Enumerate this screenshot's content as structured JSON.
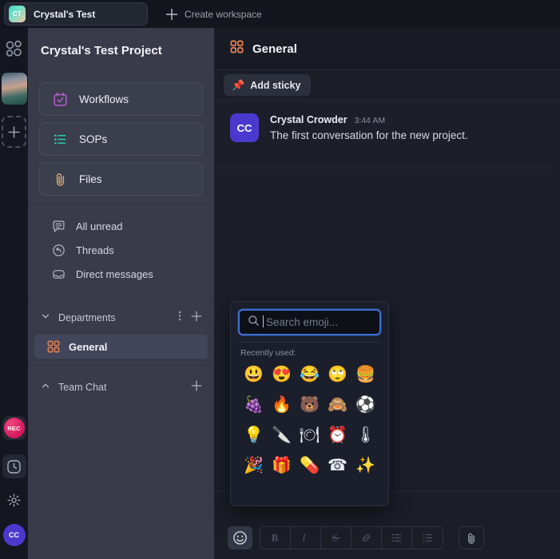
{
  "topbar": {
    "workspace_tab": {
      "initials": "CT",
      "label": "Crystal's Test",
      "icon": "workspace-avatar-icon"
    },
    "add_icon": "plus-icon",
    "create_workspace_label": "Create workspace"
  },
  "rail": {
    "logo_icon": "app-logo-icon",
    "workspace_thumb_icon": "workspace-thumbnail",
    "add_workspace_icon": "plus-icon",
    "record_label": "REC",
    "clock_icon": "clock-icon",
    "settings_icon": "gear-icon",
    "avatar_initials": "CC"
  },
  "sidebar": {
    "project_title": "Crystal's Test Project",
    "cards": [
      {
        "label": "Workflows",
        "icon": "calendar-check-icon",
        "color": "#b85bd4"
      },
      {
        "label": "SOPs",
        "icon": "list-icon",
        "color": "#2fc7b0"
      },
      {
        "label": "Files",
        "icon": "paperclip-icon",
        "color": "#d2a877"
      }
    ],
    "nav": [
      {
        "label": "All unread",
        "icon": "unread-messages-icon"
      },
      {
        "label": "Threads",
        "icon": "threads-reply-icon"
      },
      {
        "label": "Direct messages",
        "icon": "inbox-icon"
      }
    ],
    "sections": [
      {
        "title": "Departments",
        "chevron": "chevron-down-icon",
        "menu_icon": "more-vertical-icon",
        "add_icon": "plus-icon",
        "channels": [
          {
            "label": "General",
            "icon": "grid-squares-icon",
            "active": true
          }
        ]
      },
      {
        "title": "Team Chat",
        "chevron": "chevron-up-icon",
        "add_icon": "plus-icon",
        "channels": []
      }
    ]
  },
  "main": {
    "channel_icon": "grid-squares-icon",
    "channel_title": "General",
    "sticky_button": {
      "label": "Add sticky",
      "icon": "pushpin-icon"
    },
    "messages": [
      {
        "avatar_initials": "CC",
        "author": "Crystal Crowder",
        "time": "3:44 AM",
        "text": "The first conversation for the new project."
      }
    ]
  },
  "composer": {
    "emoji_button_icon": "smiley-face-icon",
    "format_buttons": [
      {
        "icon": "bold-icon",
        "label": "B"
      },
      {
        "icon": "italic-icon",
        "label": "I"
      },
      {
        "icon": "strikethrough-icon",
        "label": "S"
      },
      {
        "icon": "link-icon",
        "label": ""
      },
      {
        "icon": "bullet-list-icon",
        "label": ""
      },
      {
        "icon": "numbered-list-icon",
        "label": ""
      }
    ],
    "attach_icon": "paperclip-icon"
  },
  "emoji_picker": {
    "search_placeholder": "Search emoji...",
    "search_value": "",
    "search_icon": "search-icon",
    "recent_label": "Recently used:",
    "recent_emojis": [
      {
        "glyph": "😃",
        "name": "grinning-face-with-big-eyes"
      },
      {
        "glyph": "😍",
        "name": "smiling-face-with-heart-eyes"
      },
      {
        "glyph": "😂",
        "name": "face-with-tears-of-joy"
      },
      {
        "glyph": "🙄",
        "name": "face-with-rolling-eyes"
      },
      {
        "glyph": "🍔",
        "name": "hamburger"
      },
      {
        "glyph": "🍇",
        "name": "grapes"
      },
      {
        "glyph": "🔥",
        "name": "fire"
      },
      {
        "glyph": "🐻",
        "name": "bear-face"
      },
      {
        "glyph": "🙈",
        "name": "see-no-evil-monkey"
      },
      {
        "glyph": "⚽",
        "name": "soccer-ball"
      },
      {
        "glyph": "💡",
        "name": "light-bulb"
      },
      {
        "glyph": "🔪",
        "name": "kitchen-knife"
      },
      {
        "glyph": "🍽",
        "name": "food-cover"
      },
      {
        "glyph": "⏰",
        "name": "alarm-clock"
      },
      {
        "glyph": "🌡",
        "name": "thermometer"
      },
      {
        "glyph": "🎉",
        "name": "party-popper"
      },
      {
        "glyph": "🎁",
        "name": "wrapped-gift"
      },
      {
        "glyph": "💊",
        "name": "pill-sheet"
      },
      {
        "glyph": "☎",
        "name": "telephone"
      },
      {
        "glyph": "✨",
        "name": "sparkles"
      }
    ]
  },
  "colors": {
    "accent_blue": "#3c6fd4",
    "avatar_indigo": "#4b39cf",
    "record_red": "#d3185c",
    "sidebar_bg": "#393b4a",
    "main_bg": "#1c1f2a"
  }
}
